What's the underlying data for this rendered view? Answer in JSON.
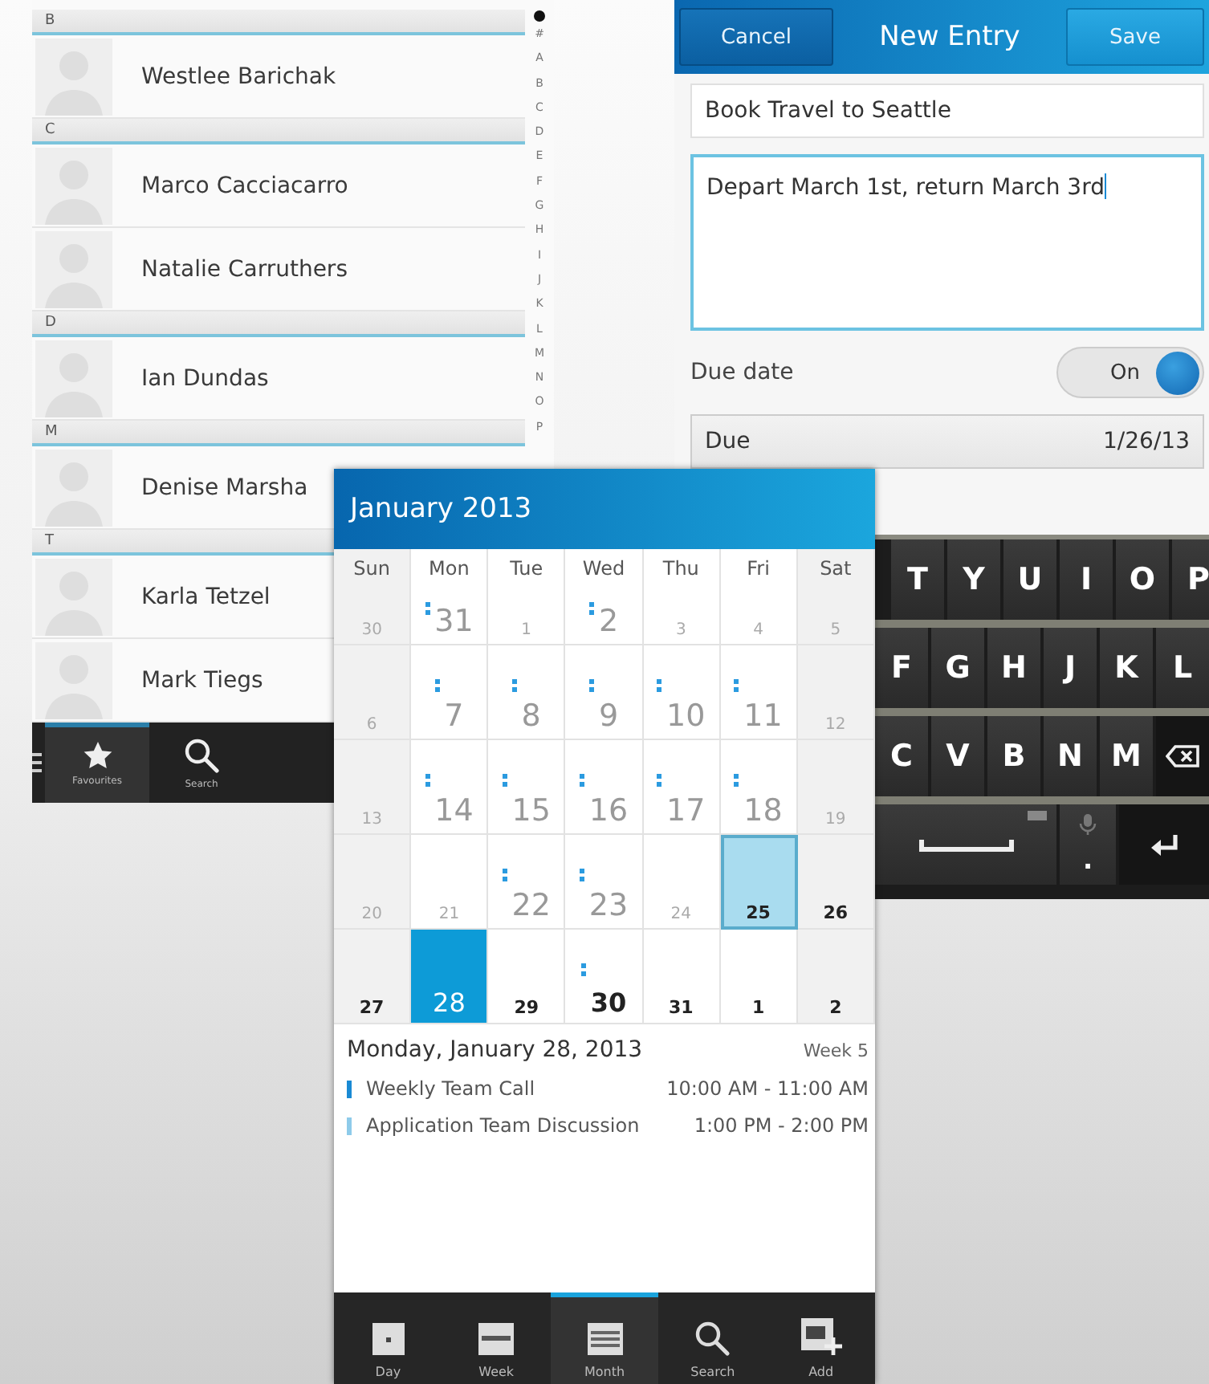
{
  "contacts": {
    "index": [
      "#",
      "A",
      "B",
      "C",
      "D",
      "E",
      "F",
      "G",
      "H",
      "I",
      "J",
      "K",
      "L",
      "M",
      "N",
      "O",
      "P"
    ],
    "sections": [
      {
        "letter": "B",
        "contacts": [
          {
            "name": "Westlee Barichak"
          }
        ]
      },
      {
        "letter": "C",
        "contacts": [
          {
            "name": "Marco Cacciacarro"
          },
          {
            "name": "Natalie Carruthers"
          }
        ]
      },
      {
        "letter": "D",
        "contacts": [
          {
            "name": "Ian Dundas"
          }
        ]
      },
      {
        "letter": "M",
        "contacts": [
          {
            "name": "Denise Marsha"
          }
        ]
      },
      {
        "letter": "T",
        "contacts": [
          {
            "name": "Karla Tetzel"
          },
          {
            "name": "Mark Tiegs"
          }
        ]
      }
    ],
    "tabs": [
      {
        "label": "Favourites",
        "selected": true
      },
      {
        "label": "Search",
        "selected": false
      }
    ]
  },
  "new_entry": {
    "title": "New Entry",
    "cancel": "Cancel",
    "save": "Save",
    "subject": "Book Travel to Seattle",
    "notes": "Depart March 1st, return March 3rd",
    "due_toggle": {
      "label": "Due date",
      "state_text": "On",
      "on": true
    },
    "due": {
      "label": "Due",
      "value": "1/26/13"
    }
  },
  "keyboard": {
    "rows": [
      [
        {
          "kind": "letter",
          "label": "T"
        },
        {
          "kind": "letter",
          "label": "Y"
        },
        {
          "kind": "letter",
          "label": "U"
        },
        {
          "kind": "letter",
          "label": "I"
        },
        {
          "kind": "letter",
          "label": "O"
        },
        {
          "kind": "letter",
          "label": "P"
        }
      ],
      [
        {
          "kind": "letter",
          "label": "F"
        },
        {
          "kind": "letter",
          "label": "G"
        },
        {
          "kind": "letter",
          "label": "H"
        },
        {
          "kind": "letter",
          "label": "J"
        },
        {
          "kind": "letter",
          "label": "K"
        },
        {
          "kind": "letter",
          "label": "L"
        }
      ],
      [
        {
          "kind": "letter",
          "label": "C"
        },
        {
          "kind": "letter",
          "label": "V"
        },
        {
          "kind": "letter",
          "label": "B"
        },
        {
          "kind": "letter",
          "label": "N"
        },
        {
          "kind": "letter",
          "label": "M"
        },
        {
          "kind": "backspace"
        }
      ],
      [
        {
          "kind": "space"
        },
        {
          "kind": "period",
          "label": "."
        },
        {
          "kind": "enter"
        }
      ]
    ]
  },
  "calendar": {
    "title": "January 2013",
    "weekdays": [
      "Sun",
      "Mon",
      "Tue",
      "Wed",
      "Thu",
      "Fri",
      "Sat"
    ],
    "weeks": [
      [
        {
          "label": "30",
          "muted": true,
          "events": false,
          "today": false,
          "selected": false
        },
        {
          "label": "31",
          "muted": true,
          "events": true,
          "today": false,
          "selected": false
        },
        {
          "label": "1",
          "muted": true,
          "events": false,
          "today": false,
          "selected": false
        },
        {
          "label": "2",
          "muted": true,
          "events": true,
          "today": false,
          "selected": false
        },
        {
          "label": "3",
          "muted": true,
          "events": false,
          "today": false,
          "selected": false
        },
        {
          "label": "4",
          "muted": true,
          "events": false,
          "today": false,
          "selected": false
        },
        {
          "label": "5",
          "muted": true,
          "events": false,
          "today": false,
          "selected": false
        }
      ],
      [
        {
          "label": "6",
          "muted": true,
          "events": false,
          "today": false,
          "selected": false
        },
        {
          "label": "7",
          "muted": true,
          "events": true,
          "today": false,
          "selected": false
        },
        {
          "label": "8",
          "muted": true,
          "events": true,
          "today": false,
          "selected": false
        },
        {
          "label": "9",
          "muted": true,
          "events": true,
          "today": false,
          "selected": false
        },
        {
          "label": "10",
          "muted": true,
          "events": true,
          "today": false,
          "selected": false
        },
        {
          "label": "11",
          "muted": true,
          "events": true,
          "today": false,
          "selected": false
        },
        {
          "label": "12",
          "muted": true,
          "events": false,
          "today": false,
          "selected": false
        }
      ],
      [
        {
          "label": "13",
          "muted": true,
          "events": false,
          "today": false,
          "selected": false
        },
        {
          "label": "14",
          "muted": true,
          "events": true,
          "today": false,
          "selected": false
        },
        {
          "label": "15",
          "muted": true,
          "events": true,
          "today": false,
          "selected": false
        },
        {
          "label": "16",
          "muted": true,
          "events": true,
          "today": false,
          "selected": false
        },
        {
          "label": "17",
          "muted": true,
          "events": true,
          "today": false,
          "selected": false
        },
        {
          "label": "18",
          "muted": true,
          "events": true,
          "today": false,
          "selected": false
        },
        {
          "label": "19",
          "muted": true,
          "events": false,
          "today": false,
          "selected": false
        }
      ],
      [
        {
          "label": "20",
          "muted": true,
          "events": false,
          "today": false,
          "selected": false
        },
        {
          "label": "21",
          "muted": true,
          "events": false,
          "today": false,
          "selected": false
        },
        {
          "label": "22",
          "muted": true,
          "events": true,
          "today": false,
          "selected": false
        },
        {
          "label": "23",
          "muted": true,
          "events": true,
          "today": false,
          "selected": false
        },
        {
          "label": "24",
          "muted": true,
          "events": false,
          "today": false,
          "selected": false
        },
        {
          "label": "25",
          "muted": false,
          "events": false,
          "today": true,
          "selected": false
        },
        {
          "label": "26",
          "muted": false,
          "events": false,
          "today": false,
          "selected": false
        }
      ],
      [
        {
          "label": "27",
          "muted": false,
          "events": false,
          "today": false,
          "selected": false
        },
        {
          "label": "28",
          "muted": false,
          "events": false,
          "today": false,
          "selected": true
        },
        {
          "label": "29",
          "muted": false,
          "events": false,
          "today": false,
          "selected": false
        },
        {
          "label": "30",
          "muted": false,
          "events": true,
          "today": false,
          "selected": false
        },
        {
          "label": "31",
          "muted": false,
          "events": false,
          "today": false,
          "selected": false
        },
        {
          "label": "1",
          "muted": false,
          "events": false,
          "today": false,
          "selected": false
        },
        {
          "label": "2",
          "muted": false,
          "events": false,
          "today": false,
          "selected": false
        }
      ]
    ],
    "agenda": {
      "date": "Monday, January 28, 2013",
      "week": "Week 5",
      "events": [
        {
          "title": "Weekly Team Call",
          "time": "10:00 AM - 11:00 AM",
          "color": "#1a8ad4"
        },
        {
          "title": "Application Team Discussion",
          "time": "1:00 PM - 2:00 PM",
          "color": "#8ecbea"
        }
      ]
    },
    "tabs": [
      {
        "label": "Day",
        "selected": false
      },
      {
        "label": "Week",
        "selected": false
      },
      {
        "label": "Month",
        "selected": true
      },
      {
        "label": "Search",
        "selected": false
      },
      {
        "label": "Add",
        "selected": false
      }
    ]
  }
}
